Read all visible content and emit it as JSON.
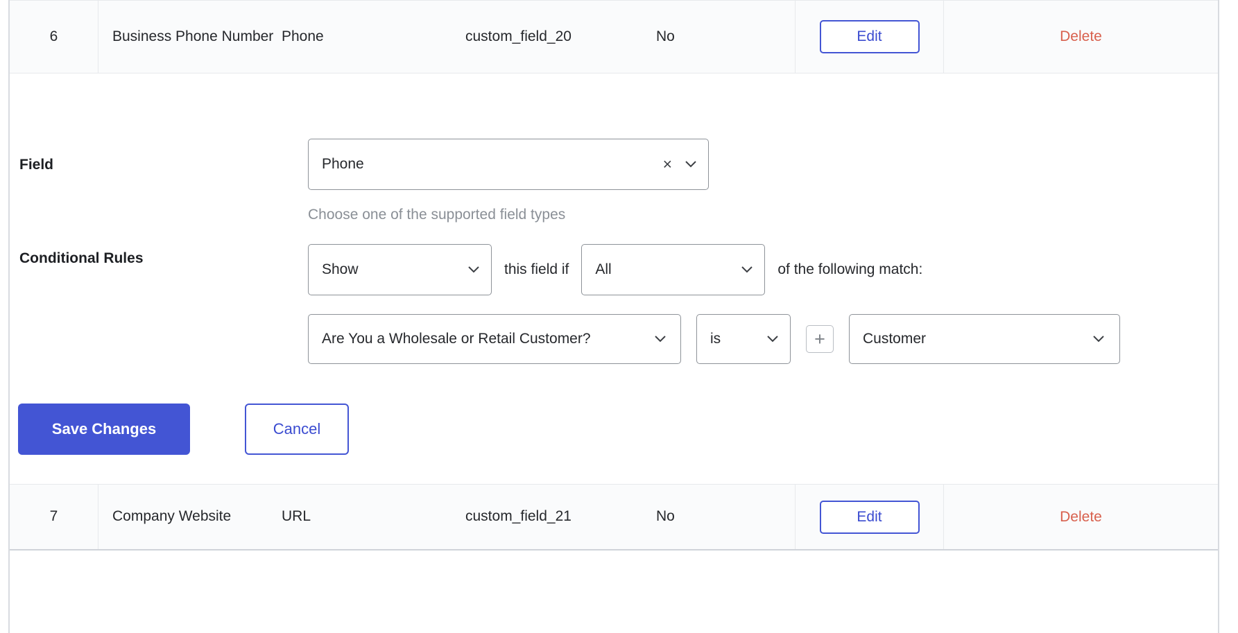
{
  "table": {
    "rows": [
      {
        "index": "6",
        "label": "Business Phone Number",
        "type": "Phone",
        "key": "custom_field_20",
        "required": "No",
        "edit_label": "Edit",
        "delete_label": "Delete"
      },
      {
        "index": "7",
        "label": "Company Website",
        "type": "URL",
        "key": "custom_field_21",
        "required": "No",
        "edit_label": "Edit",
        "delete_label": "Delete"
      }
    ]
  },
  "editor": {
    "field": {
      "label": "Field",
      "selected": "Phone",
      "clear_icon": "×",
      "helper": "Choose one of the supported field types"
    },
    "conditional_rules": {
      "label": "Conditional Rules",
      "action": "Show",
      "text_between": "this field if",
      "match_mode": "All",
      "text_after": "of the following match:",
      "condition": {
        "field": "Are You a Wholesale or Retail Customer?",
        "operator": "is",
        "add_label": "+",
        "value": "Customer"
      }
    },
    "save_label": "Save Changes",
    "cancel_label": "Cancel"
  },
  "colors": {
    "primary": "#4355d4",
    "danger": "#d8604d",
    "border": "#8d9298",
    "helper_text": "#8a8f96"
  }
}
